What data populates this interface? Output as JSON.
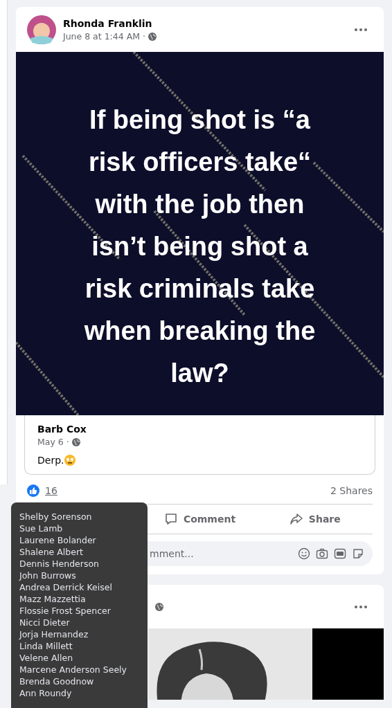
{
  "posts": [
    {
      "author": "Rhonda Franklin",
      "time": "June 8 at 1:44 AM ·",
      "meme_lines": [
        "If being shot is “a",
        "risk officers take“",
        "with the job then",
        "isn’t being shot a",
        "risk criminals take",
        "when breaking the",
        "law?"
      ],
      "shared": {
        "author": "Barb Cox",
        "time": "May 6 ·",
        "text": "Derp."
      },
      "reactions": {
        "count": "16",
        "shares": "2 Shares"
      },
      "actions": [
        {
          "label": "Comment",
          "kind": "comment"
        },
        {
          "label": "Share",
          "kind": "share"
        }
      ],
      "comment": {
        "placeholder": "mment..."
      }
    }
  ],
  "tooltip": [
    "Shelby Sorenson",
    "Sue Lamb",
    "Laurene Bolander",
    "Shalene Albert",
    "Dennis Henderson",
    "John Burrows",
    "Andrea Derrick Keisel",
    "Mazz Mazzettia",
    "Flossie Frost Spencer",
    "Nicci Dieter",
    "Jorja Hernandez",
    "Linda Millett",
    "Velene Allen",
    "Marcene Anderson Seely",
    "Brenda Goodnow",
    "Ann Roundy"
  ]
}
